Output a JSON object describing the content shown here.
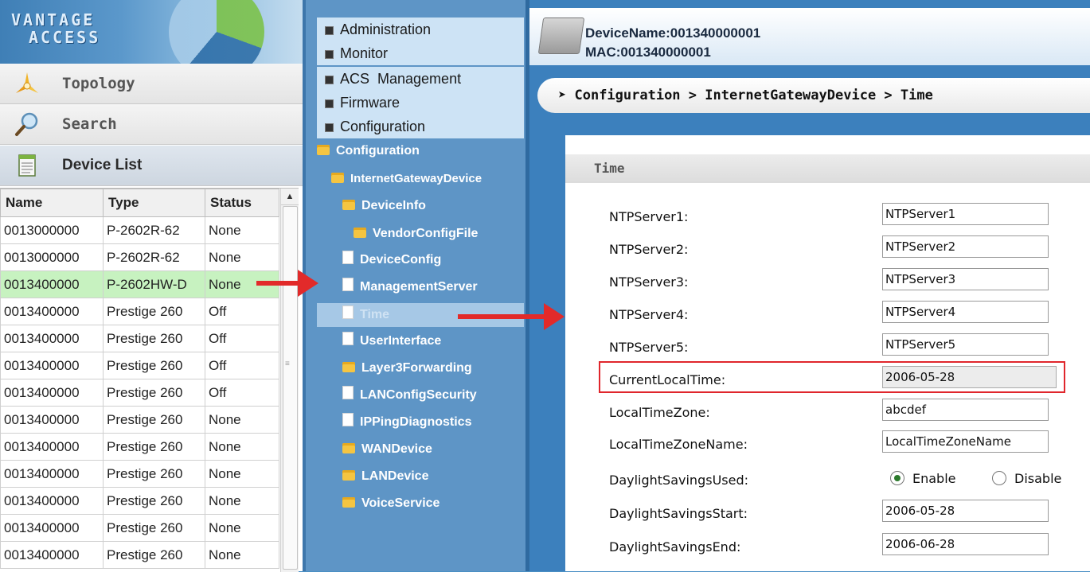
{
  "logo": {
    "line1": "VANTAGE",
    "line2": "ACCESS"
  },
  "nav": {
    "topology": "Topology",
    "search": "Search",
    "device_list": "Device List"
  },
  "device_table": {
    "columns": [
      "Name",
      "Type",
      "Status"
    ],
    "rows": [
      [
        "0013000000",
        "P-2602R-62",
        "None"
      ],
      [
        "0013000000",
        "P-2602R-62",
        "None"
      ],
      [
        "0013400000",
        "P-2602HW-D",
        "None"
      ],
      [
        "0013400000",
        "Prestige 260",
        "Off"
      ],
      [
        "0013400000",
        "Prestige 260",
        "Off"
      ],
      [
        "0013400000",
        "Prestige 260",
        "Off"
      ],
      [
        "0013400000",
        "Prestige 260",
        "Off"
      ],
      [
        "0013400000",
        "Prestige 260",
        "None"
      ],
      [
        "0013400000",
        "Prestige 260",
        "None"
      ],
      [
        "0013400000",
        "Prestige 260",
        "None"
      ],
      [
        "0013400000",
        "Prestige 260",
        "None"
      ],
      [
        "0013400000",
        "Prestige 260",
        "None"
      ],
      [
        "0013400000",
        "Prestige 260",
        "None"
      ]
    ],
    "selected_row": 2
  },
  "menu": {
    "administration": "Administration",
    "monitor": "Monitor",
    "acs_management": "ACS  Management",
    "firmware": "Firmware",
    "configuration": "Configuration"
  },
  "tree": {
    "configuration": "Configuration",
    "igd": "InternetGatewayDevice",
    "deviceinfo": "DeviceInfo",
    "vendorconfigfile": "VendorConfigFile",
    "deviceconfig": "DeviceConfig",
    "managementserver": "ManagementServer",
    "time": "Time",
    "userinterface": "UserInterface",
    "layer3forwarding": "Layer3Forwarding",
    "lanconfigsecurity": "LANConfigSecurity",
    "ippingdiagnostics": "IPPingDiagnostics",
    "wandevice": "WANDevice",
    "landevice": "LANDevice",
    "voiceservice": "VoiceService"
  },
  "device": {
    "name_line": "DeviceName:001340000001",
    "mac_line": "MAC:001340000001"
  },
  "breadcrumb": "Configuration > InternetGatewayDevice > Time",
  "panel_title": "Time",
  "fields": {
    "ntp1": {
      "label": "NTPServer1:",
      "value": "NTPServer1"
    },
    "ntp2": {
      "label": "NTPServer2:",
      "value": "NTPServer2"
    },
    "ntp3": {
      "label": "NTPServer3:",
      "value": "NTPServer3"
    },
    "ntp4": {
      "label": "NTPServer4:",
      "value": "NTPServer4"
    },
    "ntp5": {
      "label": "NTPServer5:",
      "value": "NTPServer5"
    },
    "current_local_time": {
      "label": "CurrentLocalTime:",
      "value": "2006-05-28"
    },
    "local_time_zone": {
      "label": "LocalTimeZone:",
      "value": "abcdef"
    },
    "local_time_zone_name": {
      "label": "LocalTimeZoneName:",
      "value": "LocalTimeZoneName"
    },
    "dst_used": {
      "label": "DaylightSavingsUsed:",
      "enable": "Enable",
      "disable": "Disable",
      "selected": "Enable"
    },
    "dst_start": {
      "label": "DaylightSavingsStart:",
      "value": "2006-05-28"
    },
    "dst_end": {
      "label": "DaylightSavingsEnd:",
      "value": "2006-06-28"
    }
  },
  "colors": {
    "accent_blue": "#3c80bd",
    "tree_blue": "#5e95c6",
    "highlight_red": "#e0262c",
    "selected_row": "#c7f2c0"
  }
}
